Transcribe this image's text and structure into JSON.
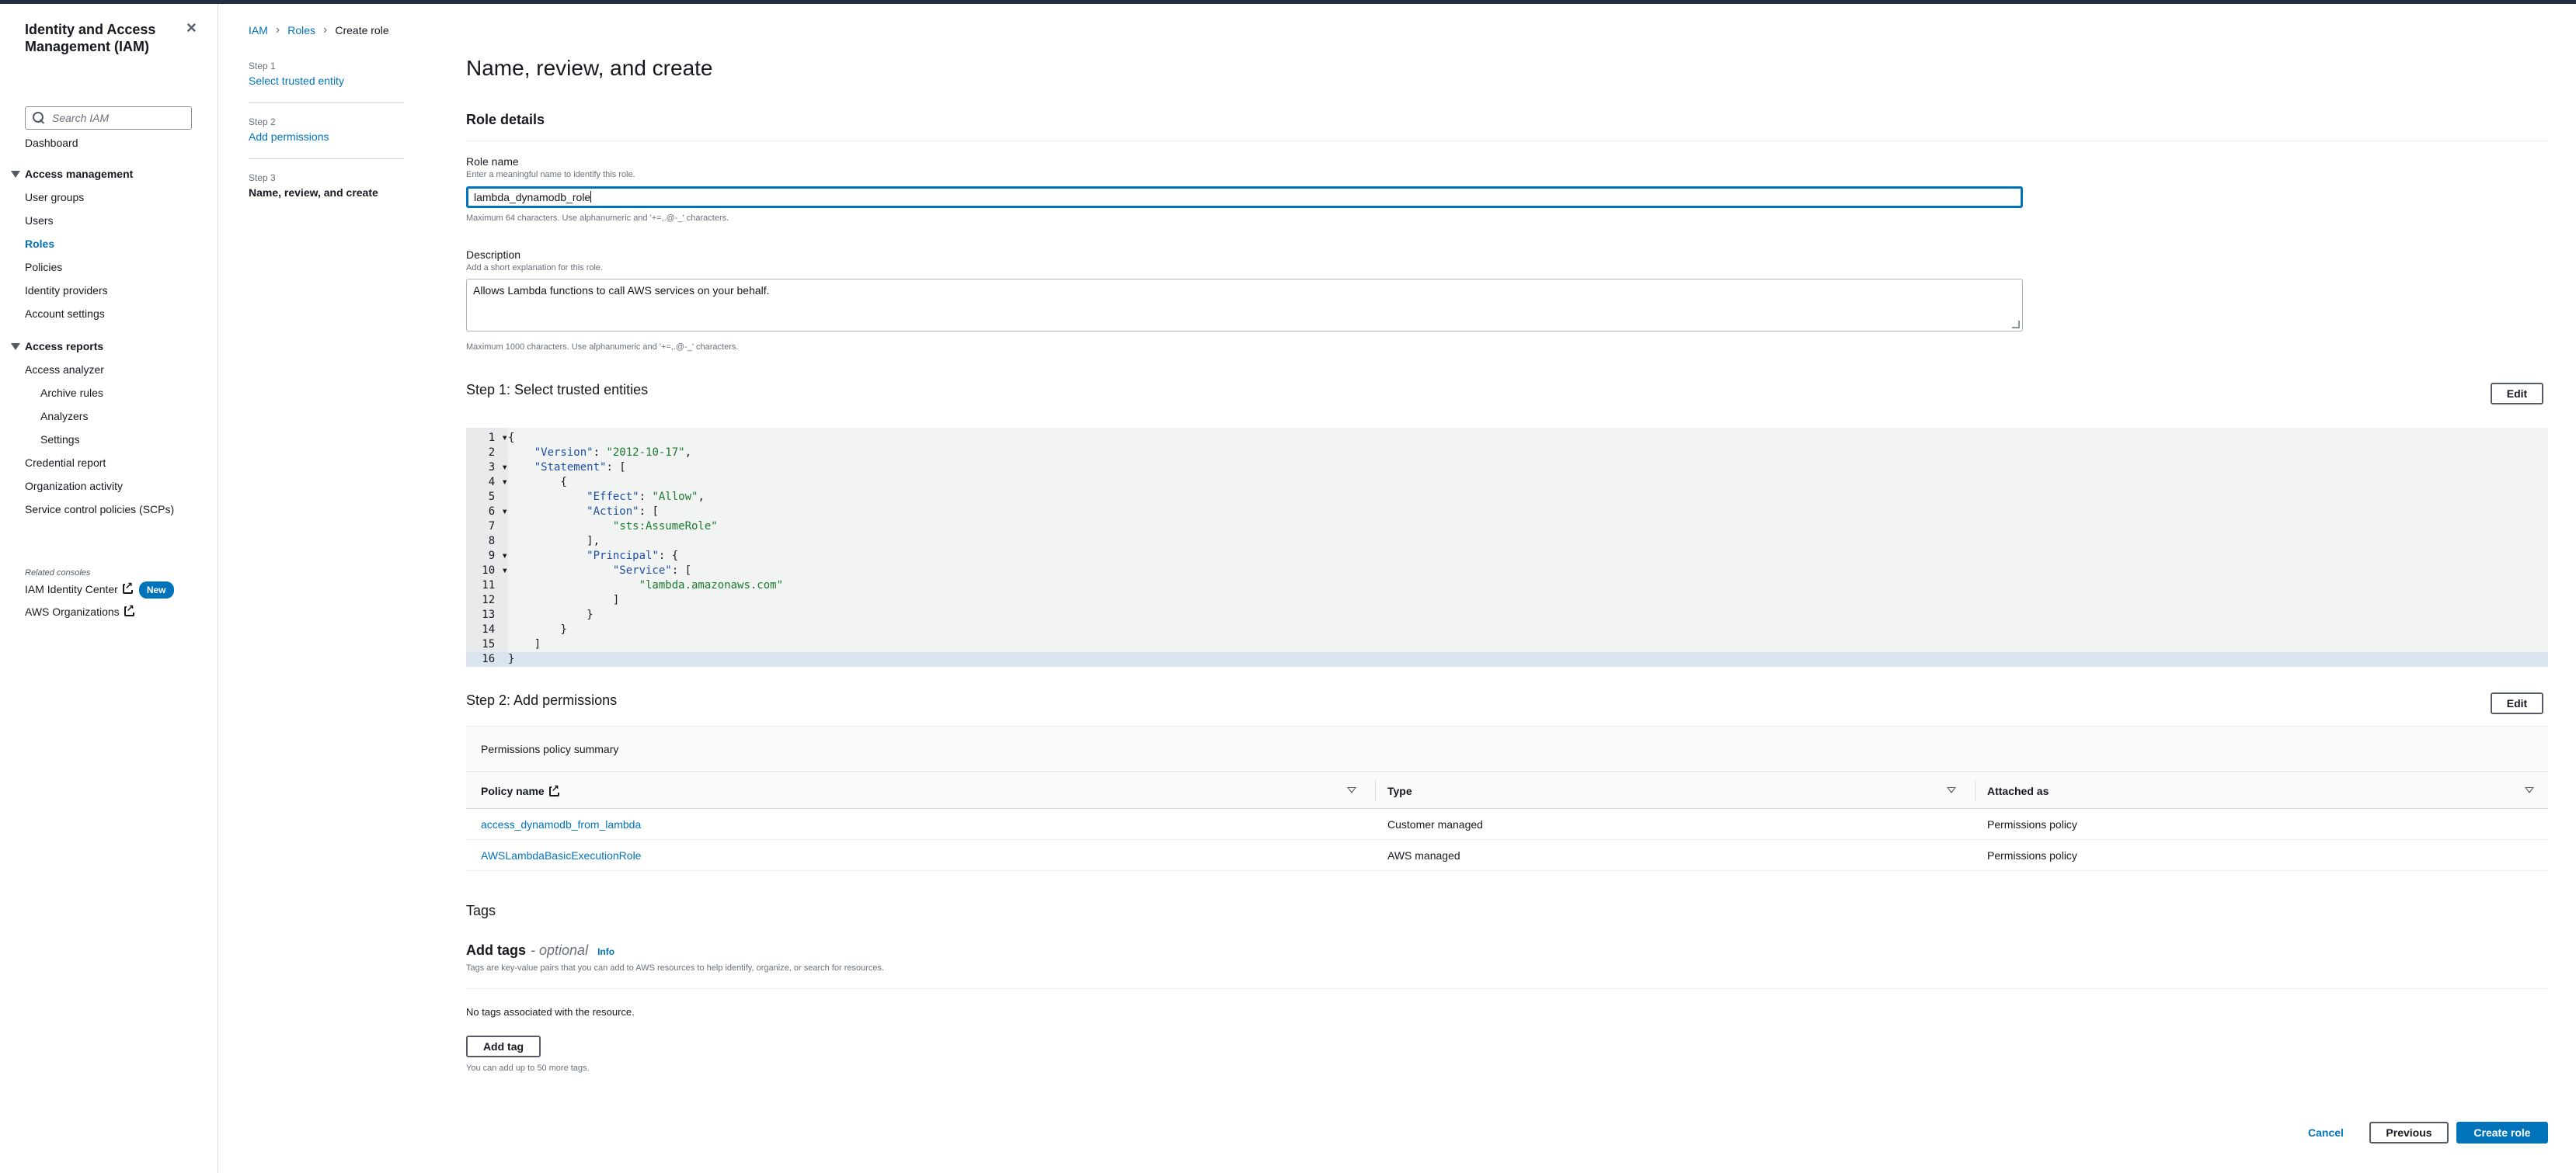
{
  "nav": {
    "title": "Identity and Access Management (IAM)",
    "search_placeholder": "Search IAM",
    "dashboard": "Dashboard",
    "access_management": "Access management",
    "items": [
      "User groups",
      "Users",
      "Roles",
      "Policies",
      "Identity providers",
      "Account settings"
    ],
    "access_reports": "Access reports",
    "reports": [
      "Access analyzer",
      "Archive rules",
      "Analyzers",
      "Settings",
      "Credential report",
      "Organization activity",
      "Service control policies (SCPs)"
    ],
    "related_label": "Related consoles",
    "identity_center": "IAM Identity Center",
    "new_badge": "New",
    "organizations": "AWS Organizations"
  },
  "breadcrumb": [
    "IAM",
    "Roles",
    "Create role"
  ],
  "wizard": {
    "steps": [
      {
        "num": "Step 1",
        "label": "Select trusted entity"
      },
      {
        "num": "Step 2",
        "label": "Add permissions"
      },
      {
        "num": "Step 3",
        "label": "Name, review, and create"
      }
    ]
  },
  "page_title": "Name, review, and create",
  "role_details": {
    "heading": "Role details",
    "name_label": "Role name",
    "name_desc": "Enter a meaningful name to identify this role.",
    "name_value": "lambda_dynamodb_role",
    "name_hint": "Maximum 64 characters. Use alphanumeric and '+=,.@-_' characters.",
    "desc_label": "Description",
    "desc_desc": "Add a short explanation for this role.",
    "desc_value": "Allows Lambda functions to call AWS services on your behalf.",
    "desc_hint": "Maximum 1000 characters. Use alphanumeric and '+=,.@-_' characters."
  },
  "step1": {
    "heading": "Step 1: Select trusted entities",
    "edit": "Edit",
    "code_lines": [
      {
        "n": "1",
        "fold": true,
        "text": "{"
      },
      {
        "n": "2",
        "fold": false,
        "text": "    \"Version\": \"2012-10-17\","
      },
      {
        "n": "3",
        "fold": true,
        "text": "    \"Statement\": ["
      },
      {
        "n": "4",
        "fold": true,
        "text": "        {"
      },
      {
        "n": "5",
        "fold": false,
        "text": "            \"Effect\": \"Allow\","
      },
      {
        "n": "6",
        "fold": true,
        "text": "            \"Action\": ["
      },
      {
        "n": "7",
        "fold": false,
        "text": "                \"sts:AssumeRole\""
      },
      {
        "n": "8",
        "fold": false,
        "text": "            ],"
      },
      {
        "n": "9",
        "fold": true,
        "text": "            \"Principal\": {"
      },
      {
        "n": "10",
        "fold": true,
        "text": "                \"Service\": ["
      },
      {
        "n": "11",
        "fold": false,
        "text": "                    \"lambda.amazonaws.com\""
      },
      {
        "n": "12",
        "fold": false,
        "text": "                ]"
      },
      {
        "n": "13",
        "fold": false,
        "text": "            }"
      },
      {
        "n": "14",
        "fold": false,
        "text": "        }"
      },
      {
        "n": "15",
        "fold": false,
        "text": "    ]"
      },
      {
        "n": "16",
        "fold": false,
        "text": "}"
      }
    ]
  },
  "step2": {
    "heading": "Step 2: Add permissions",
    "edit": "Edit",
    "summary": "Permissions policy summary",
    "columns": [
      "Policy name",
      "Type",
      "Attached as"
    ],
    "rows": [
      [
        "access_dynamodb_from_lambda",
        "Customer managed",
        "Permissions policy"
      ],
      [
        "AWSLambdaBasicExecutionRole",
        "AWS managed",
        "Permissions policy"
      ]
    ]
  },
  "tags": {
    "heading": "Tags",
    "add_heading": "Add tags",
    "optional": "- optional",
    "info": "Info",
    "desc": "Tags are key-value pairs that you can add to AWS resources to help identify, organize, or search for resources.",
    "empty": "No tags associated with the resource.",
    "add_button": "Add tag",
    "limit": "You can add up to 50 more tags."
  },
  "footer": {
    "cancel": "Cancel",
    "previous": "Previous",
    "create": "Create role"
  }
}
